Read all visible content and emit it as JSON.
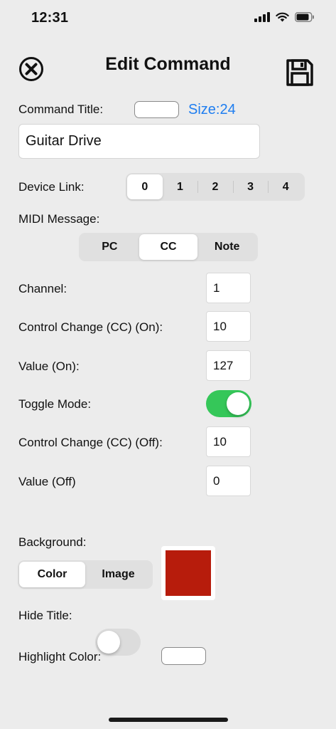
{
  "status": {
    "time": "12:31"
  },
  "header": {
    "title": "Edit Command"
  },
  "command_title": {
    "label": "Command Title:",
    "size_label": "Size:24",
    "value": "Guitar Drive"
  },
  "device_link": {
    "label": "Device Link:",
    "options": [
      "0",
      "1",
      "2",
      "3",
      "4"
    ],
    "selected": "0"
  },
  "midi_message": {
    "label": "MIDI Message:",
    "options": [
      "PC",
      "CC",
      "Note"
    ],
    "selected": "CC"
  },
  "fields": {
    "channel": {
      "label": "Channel:",
      "value": "1"
    },
    "cc_on": {
      "label": "Control Change (CC) (On):",
      "value": "10"
    },
    "value_on": {
      "label": "Value (On):",
      "value": "127"
    },
    "toggle_mode": {
      "label": "Toggle Mode:",
      "on": true
    },
    "cc_off": {
      "label": "Control Change (CC) (Off):",
      "value": "10"
    },
    "value_off": {
      "label": "Value (Off)",
      "value": "0"
    }
  },
  "background": {
    "label": "Background:",
    "options": [
      "Color",
      "Image"
    ],
    "selected": "Color",
    "color": "#b71c0c"
  },
  "hide_title": {
    "label": "Hide Title:",
    "on": false
  },
  "highlight_color": {
    "label": "Highlight Color:",
    "color": "#ffffff"
  },
  "colors": {
    "accent_blue": "#1f7ef0",
    "toggle_on": "#35c759",
    "background": "#ececec"
  }
}
